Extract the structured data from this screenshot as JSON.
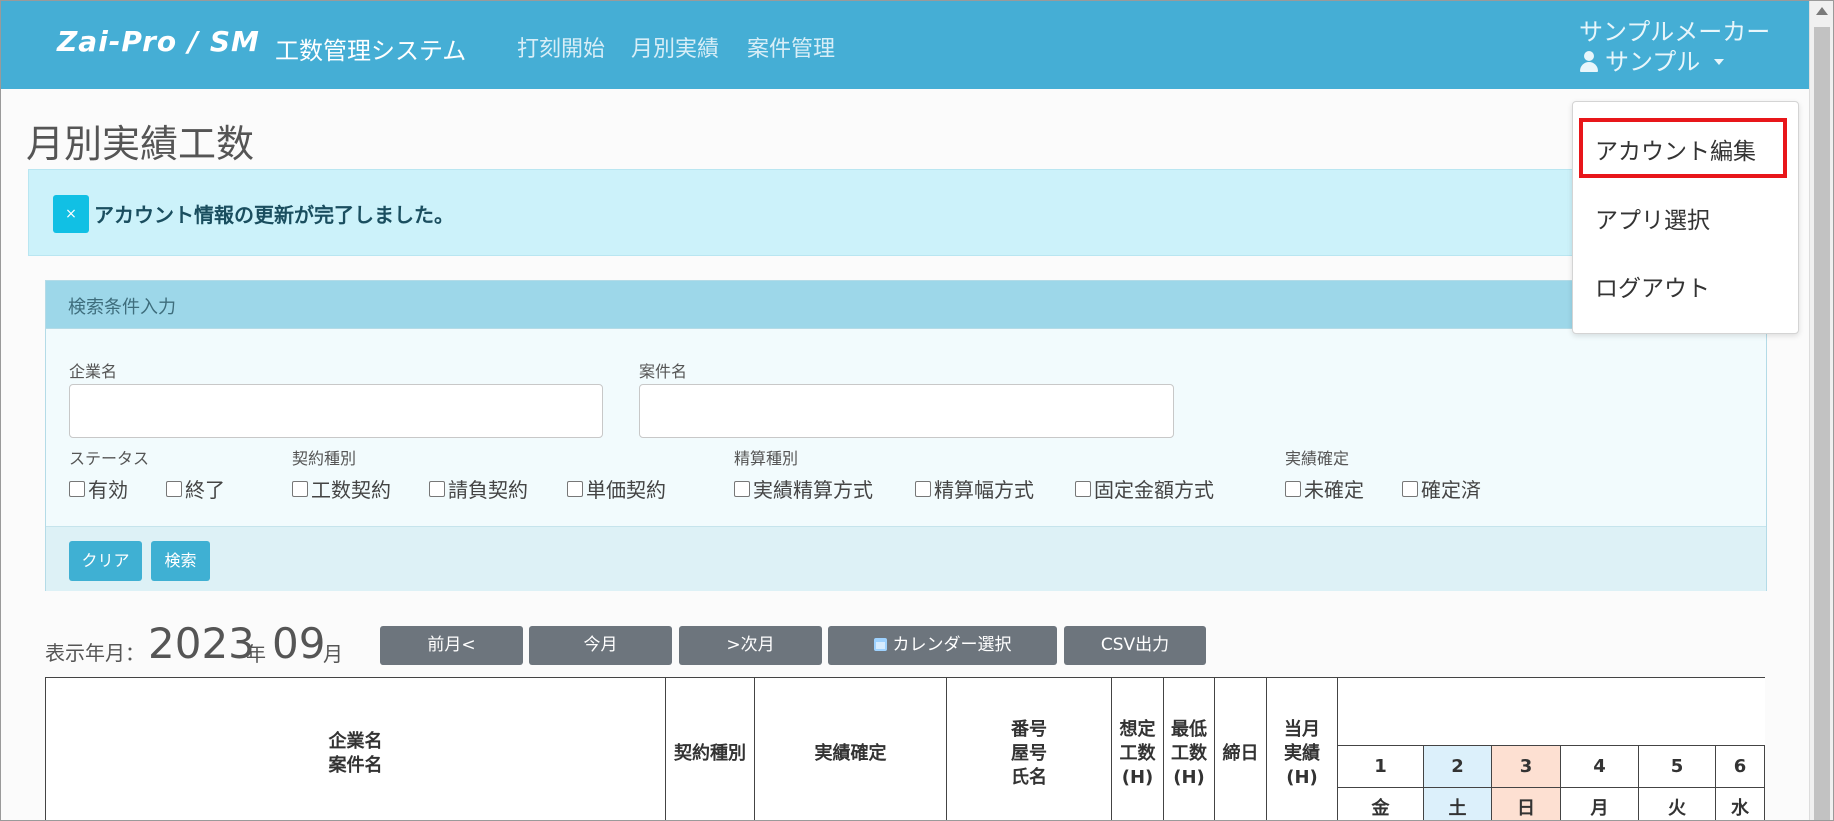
{
  "header": {
    "brand": "Zai-Pro / SM",
    "system_name": "工数管理システム",
    "nav": [
      "打刻開始",
      "月別実績",
      "案件管理"
    ],
    "company": "サンプルメーカー",
    "user": "サンプル"
  },
  "user_menu": {
    "items": [
      "アカウント編集",
      "アプリ選択",
      "ログアウト"
    ],
    "highlighted": "アカウント編集",
    "highlight_color": "#e8161a"
  },
  "page": {
    "title": "月別実績工数"
  },
  "alert": {
    "close": "×",
    "message": "アカウント情報の更新が完了しました。"
  },
  "search": {
    "title": "検索条件入力",
    "company_label": "企業名",
    "company_value": "",
    "project_label": "案件名",
    "project_value": "",
    "groups": [
      {
        "label": "ステータス",
        "options": [
          "有効",
          "終了"
        ]
      },
      {
        "label": "契約種別",
        "options": [
          "工数契約",
          "請負契約",
          "単価契約"
        ]
      },
      {
        "label": "精算種別",
        "options": [
          "実績精算方式",
          "精算幅方式",
          "固定金額方式"
        ]
      },
      {
        "label": "実績確定",
        "options": [
          "未確定",
          "確定済"
        ]
      }
    ],
    "clear_button": "クリア",
    "search_button": "検索"
  },
  "month_nav": {
    "label": "表示年月：",
    "year": "2023",
    "year_unit": "年",
    "month": "09",
    "month_unit": "月",
    "buttons": [
      "前月<",
      "今月",
      ">次月",
      "カレンダー選択",
      "CSV出力"
    ]
  },
  "table": {
    "headers": {
      "company_project": [
        "企業名",
        "案件名"
      ],
      "contract_type": "契約種別",
      "result_confirm": "実績確定",
      "numbers": [
        "番号",
        "屋号",
        "氏名"
      ],
      "assumed_hours": [
        "想定",
        "工数",
        "(H)"
      ],
      "min_hours": [
        "最低",
        "工数",
        "(H)"
      ],
      "closing_day": "締日",
      "month_result": [
        "当月",
        "実績",
        "(H)"
      ]
    },
    "days": [
      "1",
      "2",
      "3",
      "4",
      "5",
      "6"
    ],
    "weekdays": [
      "金",
      "土",
      "日",
      "月",
      "火",
      "水"
    ],
    "saturday_color": "#dcf0fb",
    "sunday_color": "#fde0d2"
  },
  "colors": {
    "navbar": "#45aed5",
    "alert_bg": "#ccf2fa",
    "panel_head": "#9dd7e9",
    "button_info": "#3fb0d3",
    "button_gray": "#6d757d"
  }
}
